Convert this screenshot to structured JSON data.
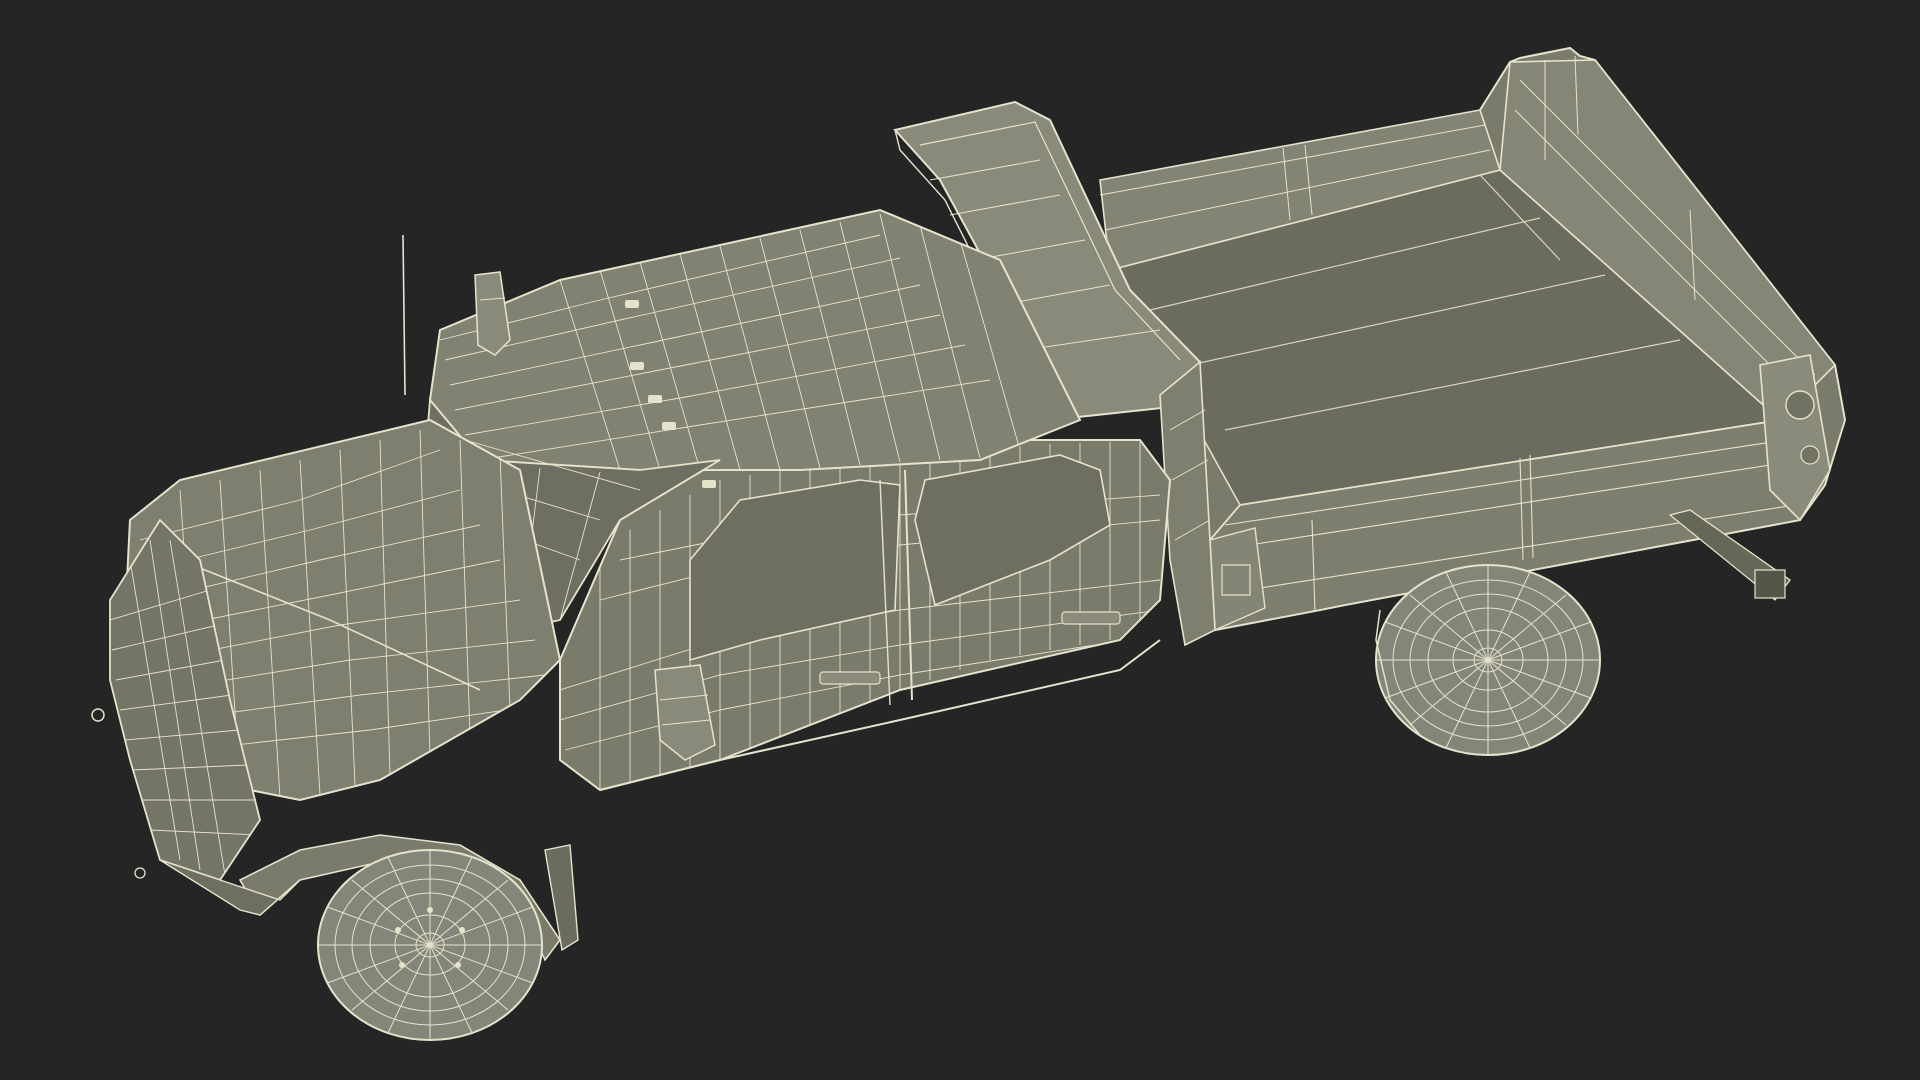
{
  "scene": {
    "subject": "wireframe-pickup-dump-truck",
    "colors": {
      "background": "#252525",
      "body_fill": "#7a7b6b",
      "body_fill_dark": "#696a5b",
      "wire": "#e6e3cc",
      "wire_dim": "#c9c6ae",
      "tire_fill": "#85867a",
      "shadow": "#4a4b40"
    }
  }
}
